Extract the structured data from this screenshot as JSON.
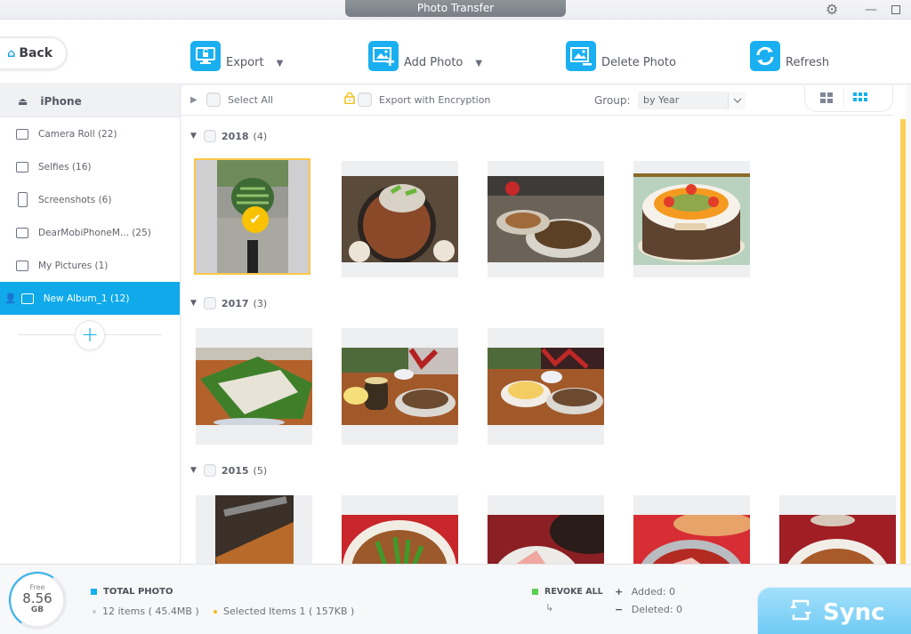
{
  "window": {
    "title": "Photo Transfer",
    "gear_icon": "⚙",
    "minimize_icon": "—"
  },
  "toolbar": {
    "back_label": "Back",
    "home_icon": "⌂",
    "export_label": "Export",
    "add_photo_label": "Add Photo",
    "delete_photo_label": "Delete Photo",
    "refresh_label": "Refresh",
    "caret": "▼"
  },
  "sidebar": {
    "device": "iPhone",
    "eject_icon": "⏏",
    "items": [
      {
        "label": "Camera Roll (22)",
        "icon": "camera-icon"
      },
      {
        "label": "Selfies (16)",
        "icon": "selfie-camera-icon"
      },
      {
        "label": "Screenshots (6)",
        "icon": "phone-icon"
      },
      {
        "label": "DearMobiPhoneM... (25)",
        "icon": "image-icon"
      },
      {
        "label": "My Pictures (1)",
        "icon": "image-icon"
      },
      {
        "label": "New Album_1 (12)",
        "icon": "image-icon",
        "active": true
      }
    ],
    "add_user_icon": "👤",
    "add_album_icon": "+"
  },
  "mainbar": {
    "select_all_label": "Select All",
    "lock_icon": "🔒",
    "encryption_label": "Export with Encryption",
    "group_label": "Group:",
    "group_value": "by Year",
    "dropdown_icon": "⌄"
  },
  "groups": [
    {
      "year": "2018",
      "count": "(4)",
      "photos": [
        "watermelon",
        "bbq-grill",
        "table-dishes",
        "fruit-cake"
      ],
      "selected_index": 0
    },
    {
      "year": "2017",
      "count": "(3)",
      "photos": [
        "rice-in-leaf",
        "pineapple-table",
        "table-snacks"
      ]
    },
    {
      "year": "2015",
      "count": "(5)",
      "photos": [
        "skewers",
        "spicy-stew",
        "pink-dish",
        "hotpot",
        "red-dish"
      ]
    }
  ],
  "checkmark": "✔",
  "bottom": {
    "free_label": "Free",
    "free_value": "8.56",
    "free_unit": "GB",
    "total_photo_label": "TOTAL PHOTO",
    "items_text": "12 items ( 45.4MB )",
    "selected_text": "Selected Items 1 ( 157KB )",
    "revoke_label": "REVOKE ALL",
    "revoke_arrow": "↳",
    "added_sym": "+",
    "added_label": "Added: 0",
    "deleted_sym": "−",
    "deleted_label": "Deleted: 0",
    "sync_label": "Sync",
    "sync_icon": "⟳"
  },
  "colors": {
    "accent": "#10aaea",
    "selection": "#fbc748",
    "scroll_thumb": "#fcd058",
    "revoke": "#5ad153"
  }
}
